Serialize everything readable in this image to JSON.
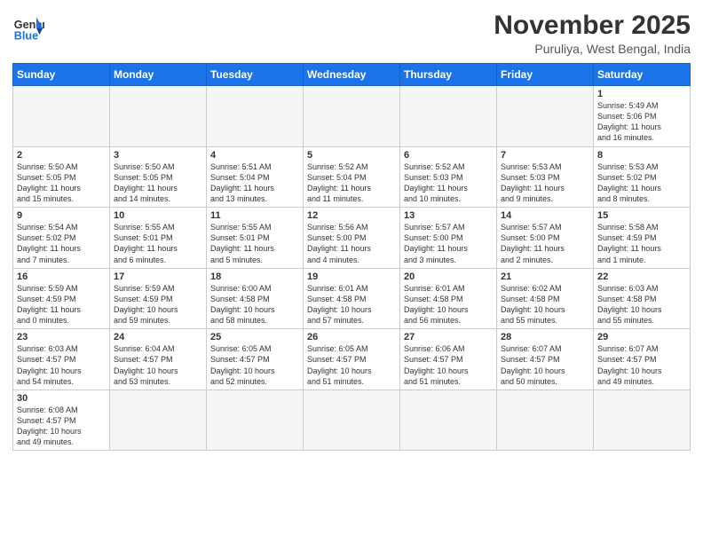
{
  "header": {
    "logo_general": "General",
    "logo_blue": "Blue",
    "month_title": "November 2025",
    "location": "Puruliya, West Bengal, India"
  },
  "weekdays": [
    "Sunday",
    "Monday",
    "Tuesday",
    "Wednesday",
    "Thursday",
    "Friday",
    "Saturday"
  ],
  "weeks": [
    [
      {
        "day": "",
        "info": ""
      },
      {
        "day": "",
        "info": ""
      },
      {
        "day": "",
        "info": ""
      },
      {
        "day": "",
        "info": ""
      },
      {
        "day": "",
        "info": ""
      },
      {
        "day": "",
        "info": ""
      },
      {
        "day": "1",
        "info": "Sunrise: 5:49 AM\nSunset: 5:06 PM\nDaylight: 11 hours\nand 16 minutes."
      }
    ],
    [
      {
        "day": "2",
        "info": "Sunrise: 5:50 AM\nSunset: 5:05 PM\nDaylight: 11 hours\nand 15 minutes."
      },
      {
        "day": "3",
        "info": "Sunrise: 5:50 AM\nSunset: 5:05 PM\nDaylight: 11 hours\nand 14 minutes."
      },
      {
        "day": "4",
        "info": "Sunrise: 5:51 AM\nSunset: 5:04 PM\nDaylight: 11 hours\nand 13 minutes."
      },
      {
        "day": "5",
        "info": "Sunrise: 5:52 AM\nSunset: 5:04 PM\nDaylight: 11 hours\nand 11 minutes."
      },
      {
        "day": "6",
        "info": "Sunrise: 5:52 AM\nSunset: 5:03 PM\nDaylight: 11 hours\nand 10 minutes."
      },
      {
        "day": "7",
        "info": "Sunrise: 5:53 AM\nSunset: 5:03 PM\nDaylight: 11 hours\nand 9 minutes."
      },
      {
        "day": "8",
        "info": "Sunrise: 5:53 AM\nSunset: 5:02 PM\nDaylight: 11 hours\nand 8 minutes."
      }
    ],
    [
      {
        "day": "9",
        "info": "Sunrise: 5:54 AM\nSunset: 5:02 PM\nDaylight: 11 hours\nand 7 minutes."
      },
      {
        "day": "10",
        "info": "Sunrise: 5:55 AM\nSunset: 5:01 PM\nDaylight: 11 hours\nand 6 minutes."
      },
      {
        "day": "11",
        "info": "Sunrise: 5:55 AM\nSunset: 5:01 PM\nDaylight: 11 hours\nand 5 minutes."
      },
      {
        "day": "12",
        "info": "Sunrise: 5:56 AM\nSunset: 5:00 PM\nDaylight: 11 hours\nand 4 minutes."
      },
      {
        "day": "13",
        "info": "Sunrise: 5:57 AM\nSunset: 5:00 PM\nDaylight: 11 hours\nand 3 minutes."
      },
      {
        "day": "14",
        "info": "Sunrise: 5:57 AM\nSunset: 5:00 PM\nDaylight: 11 hours\nand 2 minutes."
      },
      {
        "day": "15",
        "info": "Sunrise: 5:58 AM\nSunset: 4:59 PM\nDaylight: 11 hours\nand 1 minute."
      }
    ],
    [
      {
        "day": "16",
        "info": "Sunrise: 5:59 AM\nSunset: 4:59 PM\nDaylight: 11 hours\nand 0 minutes."
      },
      {
        "day": "17",
        "info": "Sunrise: 5:59 AM\nSunset: 4:59 PM\nDaylight: 10 hours\nand 59 minutes."
      },
      {
        "day": "18",
        "info": "Sunrise: 6:00 AM\nSunset: 4:58 PM\nDaylight: 10 hours\nand 58 minutes."
      },
      {
        "day": "19",
        "info": "Sunrise: 6:01 AM\nSunset: 4:58 PM\nDaylight: 10 hours\nand 57 minutes."
      },
      {
        "day": "20",
        "info": "Sunrise: 6:01 AM\nSunset: 4:58 PM\nDaylight: 10 hours\nand 56 minutes."
      },
      {
        "day": "21",
        "info": "Sunrise: 6:02 AM\nSunset: 4:58 PM\nDaylight: 10 hours\nand 55 minutes."
      },
      {
        "day": "22",
        "info": "Sunrise: 6:03 AM\nSunset: 4:58 PM\nDaylight: 10 hours\nand 55 minutes."
      }
    ],
    [
      {
        "day": "23",
        "info": "Sunrise: 6:03 AM\nSunset: 4:57 PM\nDaylight: 10 hours\nand 54 minutes."
      },
      {
        "day": "24",
        "info": "Sunrise: 6:04 AM\nSunset: 4:57 PM\nDaylight: 10 hours\nand 53 minutes."
      },
      {
        "day": "25",
        "info": "Sunrise: 6:05 AM\nSunset: 4:57 PM\nDaylight: 10 hours\nand 52 minutes."
      },
      {
        "day": "26",
        "info": "Sunrise: 6:05 AM\nSunset: 4:57 PM\nDaylight: 10 hours\nand 51 minutes."
      },
      {
        "day": "27",
        "info": "Sunrise: 6:06 AM\nSunset: 4:57 PM\nDaylight: 10 hours\nand 51 minutes."
      },
      {
        "day": "28",
        "info": "Sunrise: 6:07 AM\nSunset: 4:57 PM\nDaylight: 10 hours\nand 50 minutes."
      },
      {
        "day": "29",
        "info": "Sunrise: 6:07 AM\nSunset: 4:57 PM\nDaylight: 10 hours\nand 49 minutes."
      }
    ],
    [
      {
        "day": "30",
        "info": "Sunrise: 6:08 AM\nSunset: 4:57 PM\nDaylight: 10 hours\nand 49 minutes."
      },
      {
        "day": "",
        "info": ""
      },
      {
        "day": "",
        "info": ""
      },
      {
        "day": "",
        "info": ""
      },
      {
        "day": "",
        "info": ""
      },
      {
        "day": "",
        "info": ""
      },
      {
        "day": "",
        "info": ""
      }
    ]
  ]
}
